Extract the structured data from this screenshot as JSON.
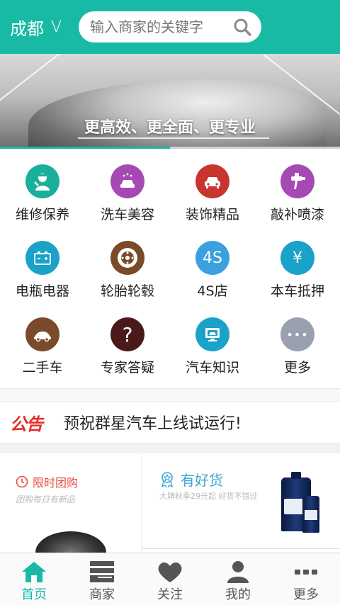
{
  "header": {
    "city": "成都",
    "city_chevron": "V",
    "search_placeholder": "输入商家的关键字",
    "search_icon": "search-icon"
  },
  "banner": {
    "slogan": "更高效、更全面、更专业",
    "progress": 0.5
  },
  "categories": [
    {
      "label": "维修保养",
      "icon": "mechanic-icon",
      "color": "#1aaf9a"
    },
    {
      "label": "洗车美容",
      "icon": "car-wash-icon",
      "color": "#a44ab2"
    },
    {
      "label": "装饰精品",
      "icon": "car-front-icon",
      "color": "#c8352f"
    },
    {
      "label": "敲补喷漆",
      "icon": "spray-gun-icon",
      "color": "#a44ab2"
    },
    {
      "label": "电瓶电器",
      "icon": "battery-icon",
      "color": "#1aa2c8"
    },
    {
      "label": "轮胎轮毂",
      "icon": "tire-icon",
      "color": "#7a4a2a"
    },
    {
      "label": "4S店",
      "icon_text": "4S",
      "icon": "4s-store-icon",
      "color": "#3aa0e0"
    },
    {
      "label": "本车抵押",
      "icon_text": "¥",
      "icon": "yen-icon",
      "color": "#1aa2c8"
    },
    {
      "label": "二手车",
      "icon": "used-car-icon",
      "color": "#7a4a2a"
    },
    {
      "label": "专家答疑",
      "icon_text": "?",
      "icon": "question-icon",
      "color": "#4a1a1a"
    },
    {
      "label": "汽车知识",
      "icon": "monitor-icon",
      "color": "#1aa2c8"
    },
    {
      "label": "更多",
      "icon_text": "•••",
      "icon": "more-dots-icon",
      "color": "#9aa0b0"
    }
  ],
  "notice": {
    "tag": "公告",
    "text": "预祝群星汽车上线试运行!"
  },
  "promos": {
    "left": {
      "title": "限时团购",
      "subtitle": "团购每日有新品",
      "icon": "clock-icon"
    },
    "right": {
      "title": "有好货",
      "subtitle": "大牌秋季29元起  好货不错过",
      "icon": "ribbon-icon"
    }
  },
  "tabbar": [
    {
      "label": "首页",
      "icon": "home-icon",
      "active": true
    },
    {
      "label": "商家",
      "icon": "store-icon",
      "active": false
    },
    {
      "label": "关注",
      "icon": "heart-icon",
      "active": false
    },
    {
      "label": "我的",
      "icon": "user-icon",
      "active": false
    },
    {
      "label": "更多",
      "icon": "more-icon",
      "active": false
    }
  ],
  "colors": {
    "accent": "#18b9a5",
    "notice_red": "#e52d27",
    "promo_red": "#e74c3c",
    "promo_blue": "#3fa3d6"
  }
}
